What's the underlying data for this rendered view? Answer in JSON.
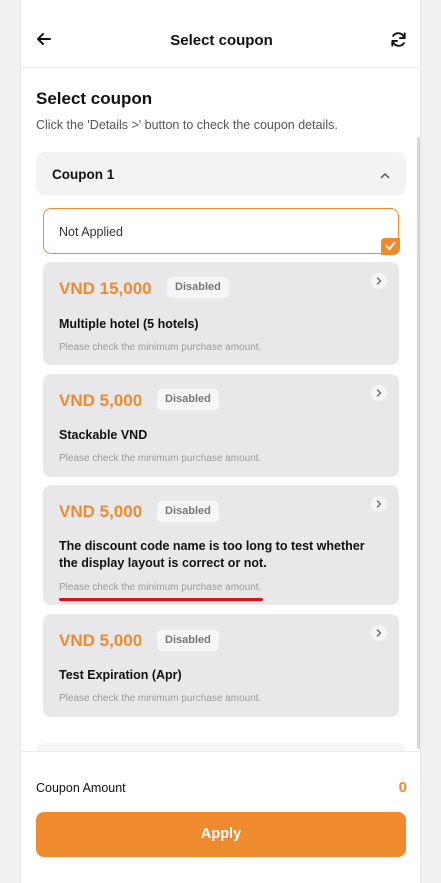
{
  "header": {
    "title": "Select coupon",
    "back_icon": "arrow-left-icon",
    "refresh_icon": "refresh-icon"
  },
  "section": {
    "heading": "Select coupon",
    "subtitle": "Click the 'Details >' button to check the coupon details."
  },
  "accordion": {
    "label": "Coupon 1",
    "expanded": true
  },
  "not_applied": {
    "label": "Not Applied",
    "selected": true
  },
  "coupons": [
    {
      "price": "VND 15,000",
      "badge": "Disabled",
      "name": "Multiple hotel (5 hotels)",
      "note": "Please check the minimum purchase amount."
    },
    {
      "price": "VND 5,000",
      "badge": "Disabled",
      "name": "Stackable VND",
      "note": "Please check the minimum purchase amount."
    },
    {
      "price": "VND 5,000",
      "badge": "Disabled",
      "name": "The discount code name is too long to test whether the display layout is correct or not.",
      "note": "Please check the minimum purchase amount."
    },
    {
      "price": "VND 5,000",
      "badge": "Disabled",
      "name": "Test Expiration (Apr)",
      "note": "Please check the minimum purchase amount."
    }
  ],
  "footer": {
    "amount_label": "Coupon Amount",
    "amount_value": "0",
    "apply_label": "Apply"
  },
  "colors": {
    "accent": "#ef8a2e",
    "card_bg": "#e8e8ea",
    "annotation_underline": "#e0101a"
  }
}
